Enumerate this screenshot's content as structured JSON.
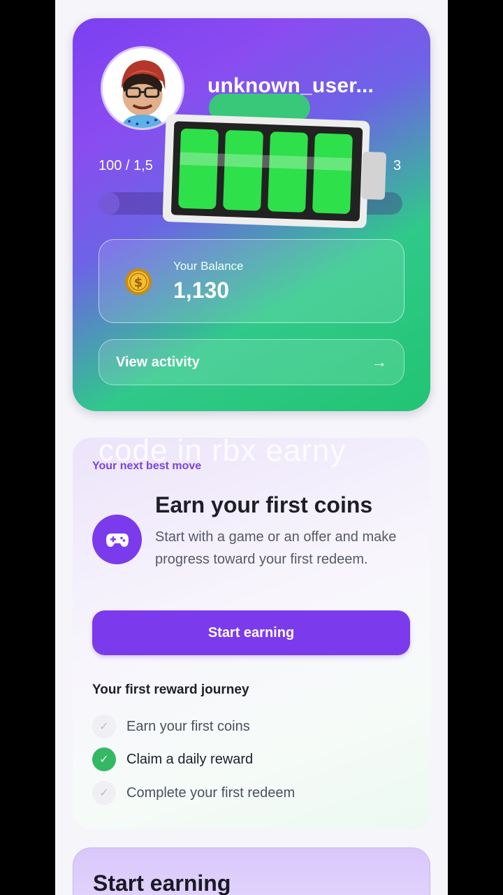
{
  "profile": {
    "username": "unknown_user...",
    "xp_left": "100 / 1,5",
    "xp_right": "3",
    "xp_progress_fraction": 0.07,
    "balance_label": "Your Balance",
    "balance_value": "1,130",
    "view_activity_label": "View activity",
    "arrow_glyph": "→",
    "colors": {
      "card_purple": "#7b3ff2",
      "card_green": "#22c472"
    }
  },
  "overlay": {
    "watermark_text": "code in rbx earny",
    "sticker_icon": "full-battery-icon"
  },
  "next_move": {
    "eyebrow": "Your next best move",
    "title": "Earn your first coins",
    "description": "Start with a game or an offer and make progress toward your first redeem.",
    "icon": "gamepad-icon",
    "cta_label": "Start earning",
    "journey_title": "Your first reward journey",
    "journey_items": [
      {
        "label": "Earn your first coins",
        "done": false,
        "glyph": "✓"
      },
      {
        "label": "Claim a daily reward",
        "done": true,
        "glyph": "✓"
      },
      {
        "label": "Complete your first redeem",
        "done": false,
        "glyph": "✓"
      }
    ],
    "accent": "#7c3aed"
  },
  "bottom_section": {
    "title": "Start earning"
  }
}
